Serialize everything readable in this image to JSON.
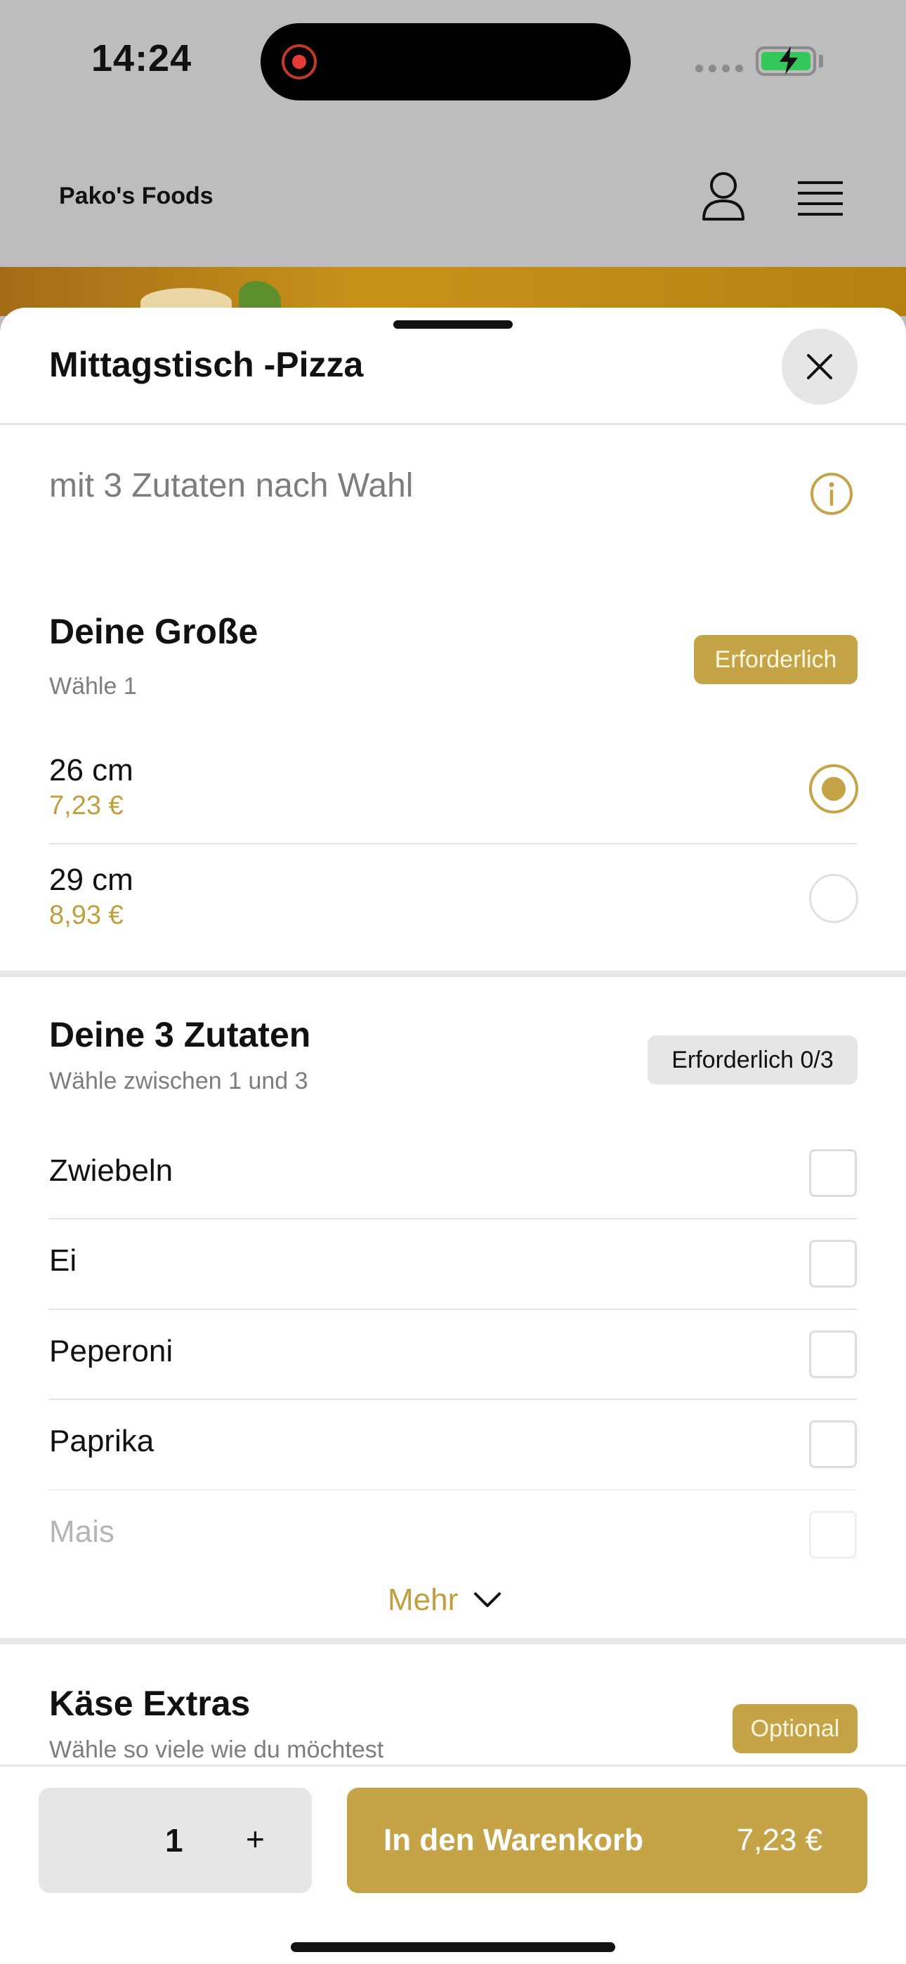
{
  "status_bar": {
    "time": "14:24"
  },
  "header": {
    "brand": "Pako's Foods"
  },
  "sheet": {
    "title": "Mittagstisch -Pizza",
    "description": "mit 3 Zutaten nach Wahl"
  },
  "size_section": {
    "title": "Deine Große",
    "subtitle": "Wähle 1",
    "badge": "Erforderlich",
    "options": [
      {
        "name": "26 cm",
        "price": "7,23 €",
        "selected": true
      },
      {
        "name": "29 cm",
        "price": "8,93 €",
        "selected": false
      }
    ]
  },
  "toppings_section": {
    "title": "Deine 3 Zutaten",
    "subtitle": "Wähle zwischen 1 und 3",
    "badge": "Erforderlich 0/3",
    "items": [
      "Zwiebeln",
      "Ei",
      "Peperoni",
      "Paprika",
      "Mais"
    ],
    "more_label": "Mehr"
  },
  "cheese_section": {
    "title": "Käse Extras",
    "subtitle": "Wähle so viele wie du möchtest",
    "badge": "Optional"
  },
  "bottom_bar": {
    "quantity": "1",
    "plus": "+",
    "cart_label": "In den Warenkorb",
    "cart_price": "7,23 €"
  },
  "colors": {
    "accent": "#c4a447",
    "price": "#bf9f3f",
    "muted": "#7d7d7d"
  }
}
